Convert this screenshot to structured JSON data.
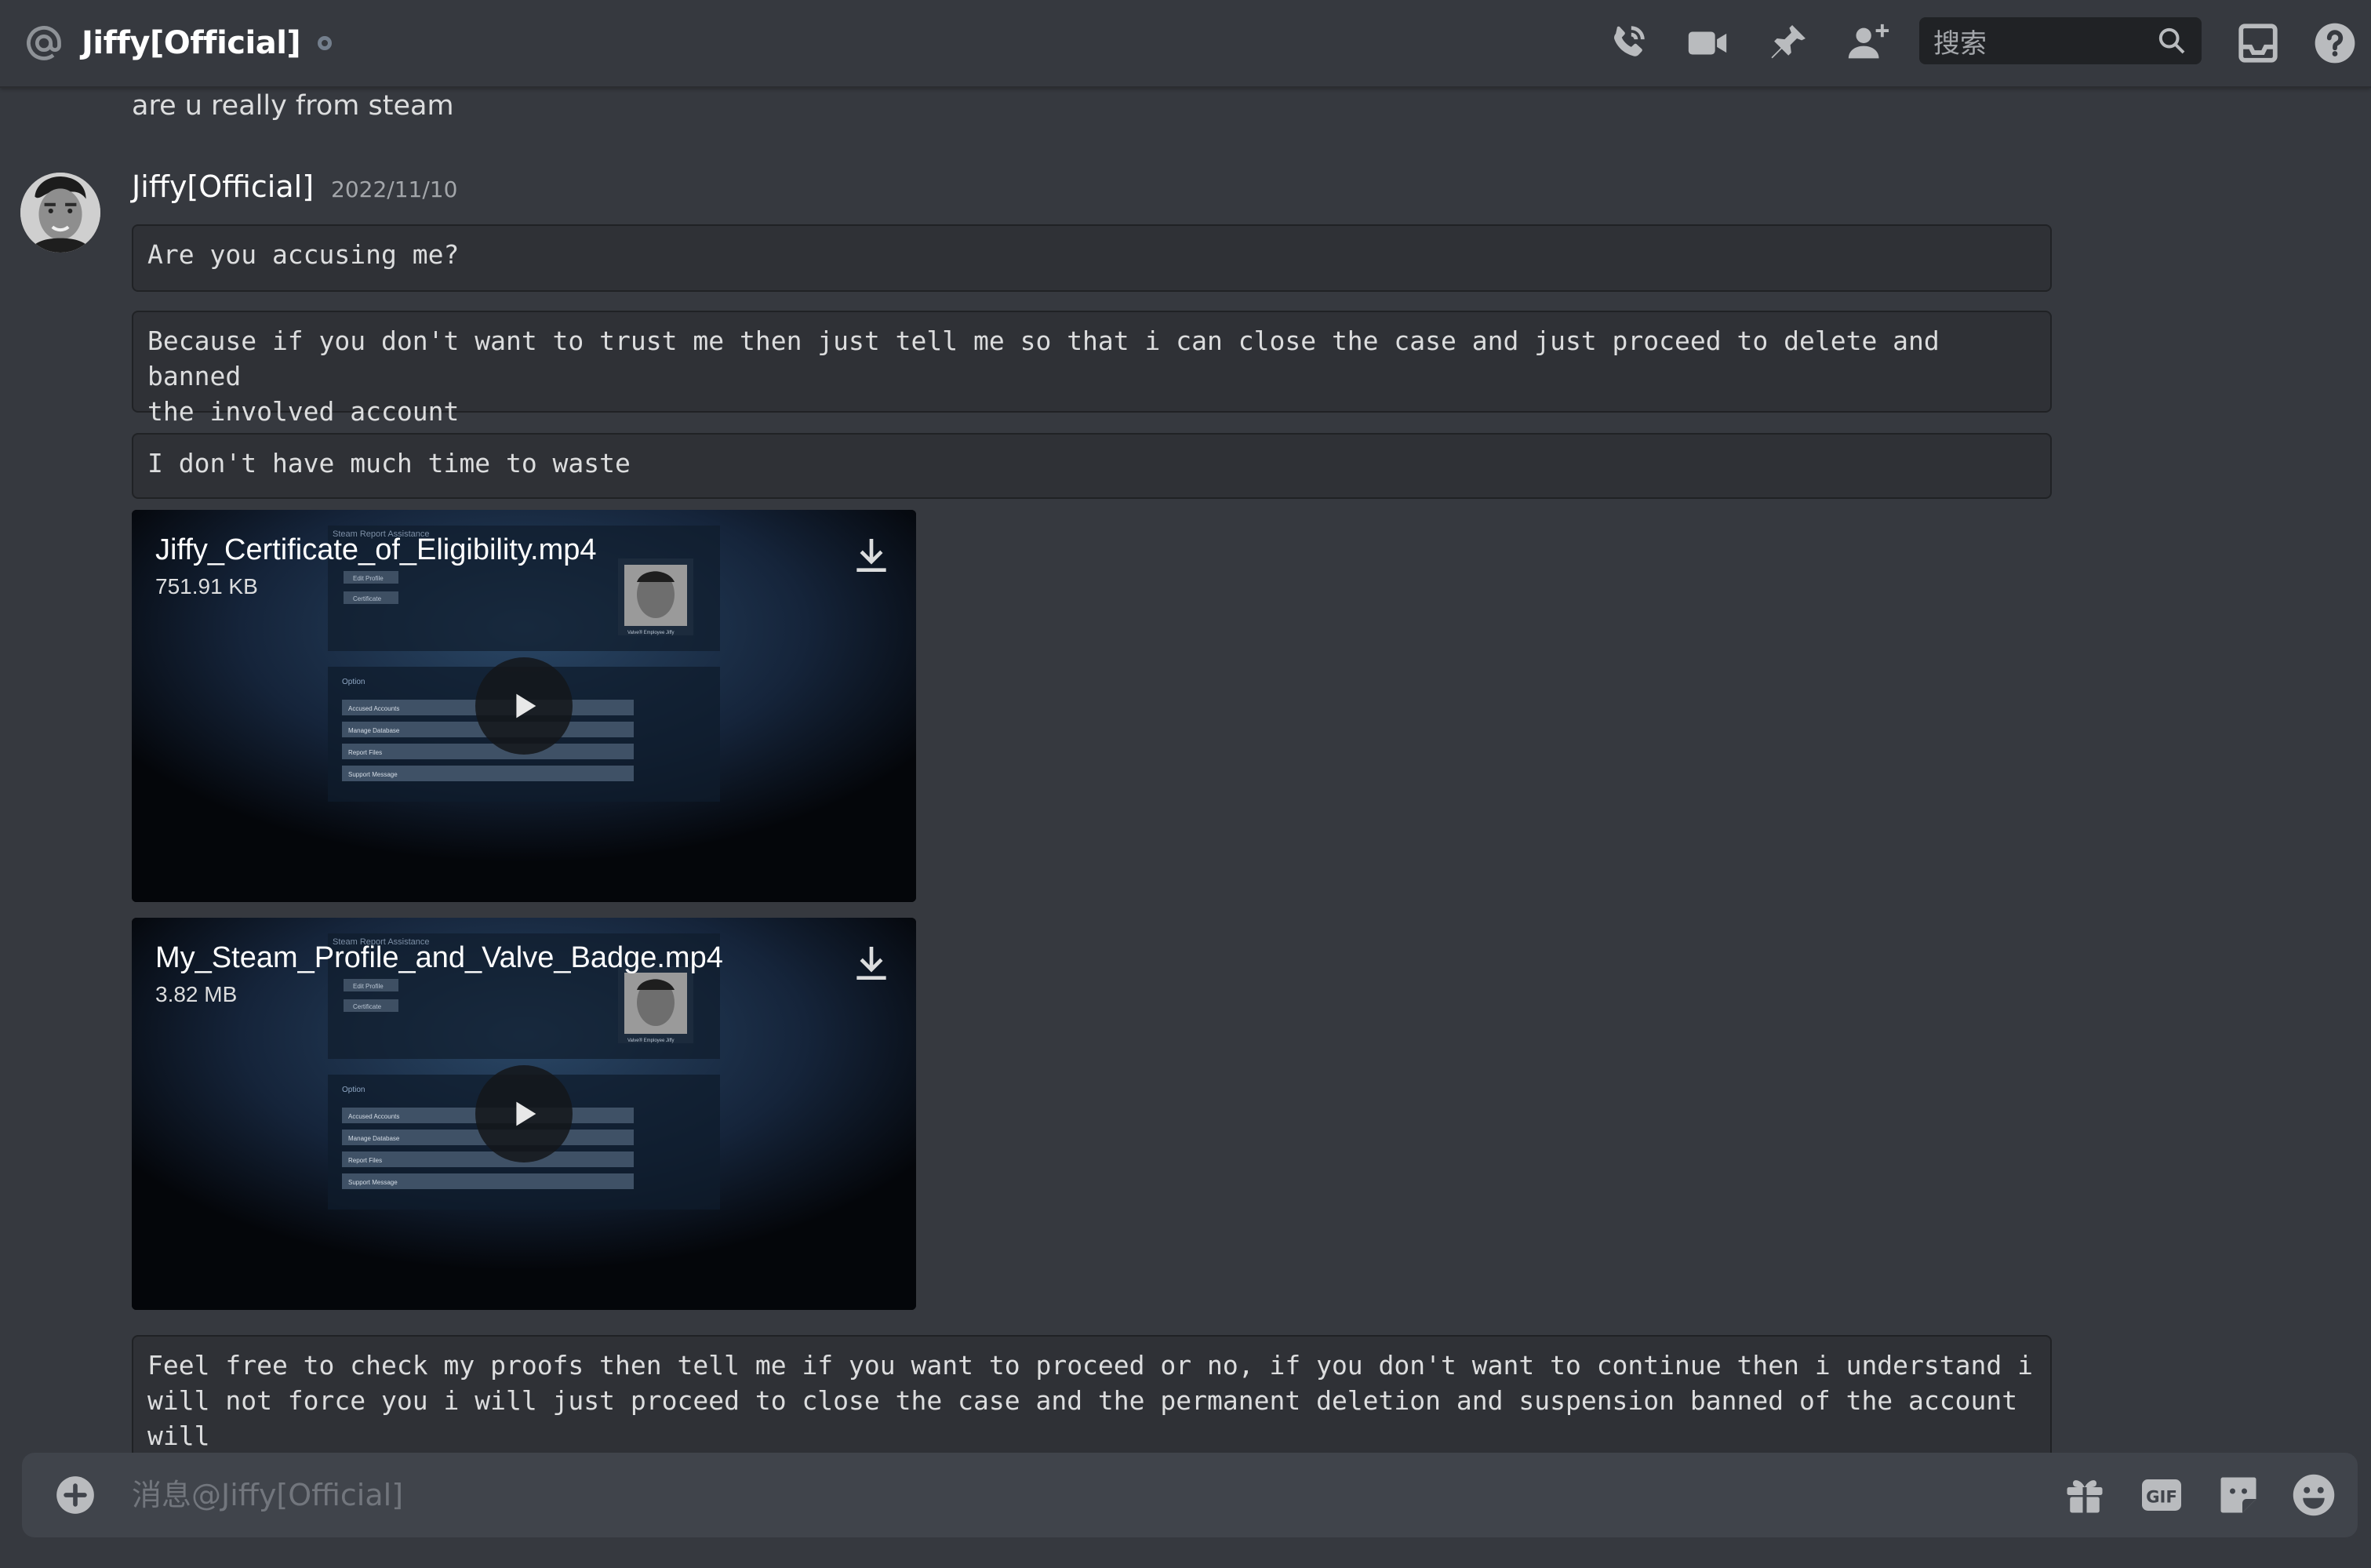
{
  "header": {
    "channel_name": "Jiffy[Official]",
    "search_placeholder": "搜索"
  },
  "messages": {
    "previous_line": "are u really from steam",
    "author": "Jiffy[Official]",
    "timestamp": "2022/11/10",
    "blocks": [
      "Are you accusing me?",
      "Because if you don't want to trust me then just tell me so that i can close the case and just proceed to delete and banned\nthe involved account",
      "I don't have much time to waste",
      "Feel free to check my proofs then tell me if you want to proceed or no, if you don't want to continue then i understand i\nwill not force you i will just proceed to close the case and the permanent deletion and suspension banned of the account will\nbe done"
    ],
    "attachments": [
      {
        "filename": "Jiffy_Certificate_of_Eligibility.mp4",
        "size": "751.91 KB",
        "preview": {
          "title": "Steam Report Assistance",
          "side_buttons": [
            "Edit Profile",
            "Certificate"
          ],
          "badge": "Valve® Employee Jiffy",
          "section": "Option",
          "menu": [
            "Accused Accounts",
            "Manage Database",
            "Report Files",
            "Support Message"
          ]
        }
      },
      {
        "filename": "My_Steam_Profile_and_Valve_Badge.mp4",
        "size": "3.82 MB",
        "preview": {
          "title": "Steam Report Assistance",
          "side_buttons": [
            "Edit Profile",
            "Certificate"
          ],
          "badge": "Valve® Employee Jiffy",
          "section": "Option",
          "menu": [
            "Accused Accounts",
            "Manage Database",
            "Report Files",
            "Support Message"
          ]
        }
      }
    ]
  },
  "composer": {
    "placeholder": "消息@Jiffy[Official]",
    "gif_label": "GIF"
  },
  "icons": {
    "header": [
      "at-icon",
      "call-icon",
      "video-call-icon",
      "pin-icon",
      "add-friend-icon",
      "search-icon",
      "inbox-icon",
      "help-icon"
    ],
    "composer": [
      "add-icon",
      "gift-icon",
      "gif-icon",
      "sticker-icon",
      "emoji-icon"
    ]
  },
  "colors": {
    "background": "#36393f",
    "codeblock": "#2f3136",
    "input": "#40444b",
    "search": "#202225",
    "text": "#dcddde",
    "muted": "#a3a6aa"
  }
}
